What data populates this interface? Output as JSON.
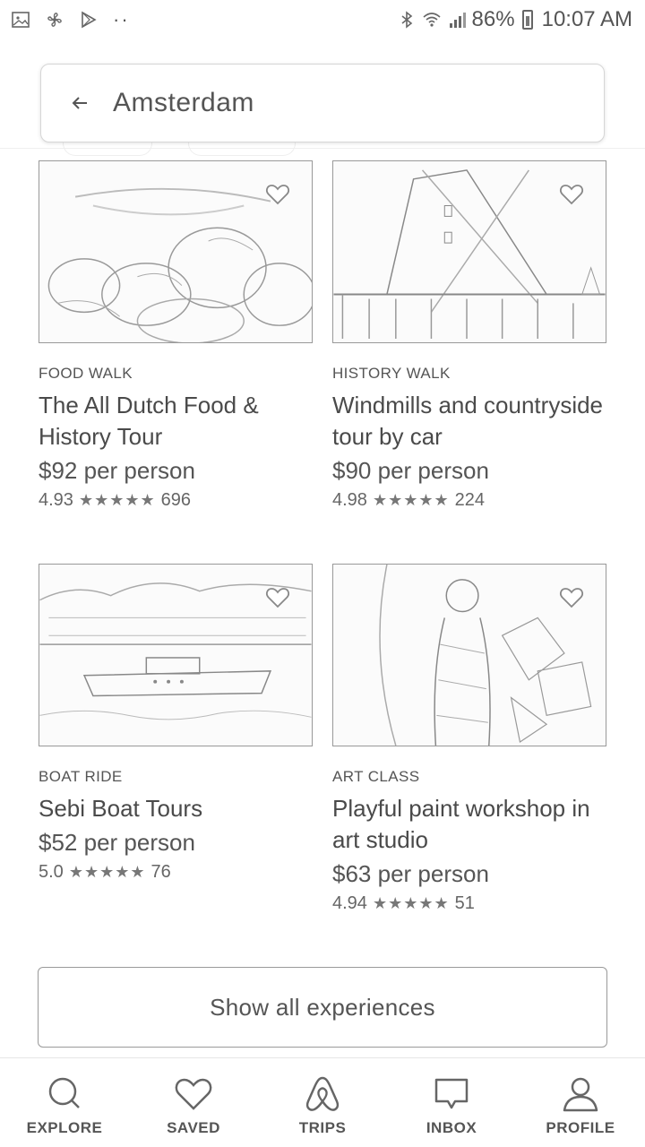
{
  "status_bar": {
    "left_icons": [
      "image-icon",
      "pinwheel-icon",
      "play-store-icon"
    ],
    "dots": "··",
    "battery": "86%",
    "time": "10:07 AM"
  },
  "search": {
    "value": "Amsterdam"
  },
  "cards": [
    {
      "category": "FOOD WALK",
      "title": "The All Dutch Food & History Tour",
      "price": "$92 per person",
      "rating": "4.93",
      "stars": "★★★★★",
      "reviews": "696"
    },
    {
      "category": "HISTORY WALK",
      "title": "Windmills and countryside tour by car",
      "price": "$90 per person",
      "rating": "4.98",
      "stars": "★★★★★",
      "reviews": "224"
    },
    {
      "category": "BOAT RIDE",
      "title": "Sebi Boat Tours",
      "price": "$52 per person",
      "rating": "5.0",
      "stars": "★★★★★",
      "reviews": "76"
    },
    {
      "category": "ART CLASS",
      "title": "Playful paint workshop in art studio",
      "price": "$63 per person",
      "rating": "4.94",
      "stars": "★★★★★",
      "reviews": "51"
    }
  ],
  "show_all_label": "Show all experiences",
  "nav": {
    "explore": "EXPLORE",
    "saved": "SAVED",
    "trips": "TRIPS",
    "inbox": "INBOX",
    "profile": "PROFILE"
  }
}
